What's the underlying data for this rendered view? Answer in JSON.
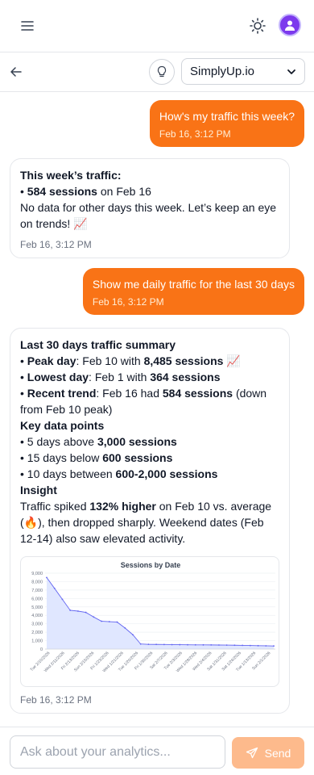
{
  "header": {
    "menu_icon": "hamburger-icon",
    "theme_icon": "sun-icon",
    "avatar_icon": "user-icon"
  },
  "subheader": {
    "back_icon": "arrow-left-icon",
    "bulb_icon": "lightbulb-icon",
    "site_select": {
      "selected": "SimplyUp.io"
    }
  },
  "messages": [
    {
      "role": "user",
      "text": "How's my traffic this week?",
      "time": "Feb 16, 3:12 PM"
    },
    {
      "role": "assistant",
      "heading": "This week’s traffic:",
      "line1_bold": "584 sessions",
      "line1_rest": " on Feb 16",
      "line2": "No data for other days this week. Let’s keep an eye on trends! 📈",
      "time": "Feb 16, 3:12 PM"
    },
    {
      "role": "user",
      "text": "Show me daily traffic for the last 30 days",
      "time": "Feb 16, 3:12 PM"
    },
    {
      "role": "assistant",
      "title": "Last 30 days traffic summary",
      "peak_label": "Peak day",
      "peak_mid": ": Feb 10 with ",
      "peak_value": "8,485 sessions",
      "peak_emoji": " 📈",
      "lowest_label": "Lowest day",
      "lowest_mid": ": Feb 1 with ",
      "lowest_value": "364 sessions",
      "recent_label": "Recent trend",
      "recent_mid": ": Feb 16 had ",
      "recent_value": "584 sessions",
      "recent_rest": " (down from Feb 10 peak)",
      "key_heading": "Key data points",
      "kp1_pre": "5 days above ",
      "kp1_bold": "3,000 sessions",
      "kp2_pre": "15 days below ",
      "kp2_bold": "600 sessions",
      "kp3_pre": "10 days between ",
      "kp3_bold": "600-2,000 sessions",
      "insight_heading": "Insight",
      "insight_pre": "Traffic spiked ",
      "insight_bold": "132% higher",
      "insight_rest": " on Feb 10 vs. average (🔥), then dropped sharply. Weekend dates (Feb 12-14) also saw elevated activity.",
      "time": "Feb 16, 3:12 PM"
    }
  ],
  "chart_data": {
    "type": "area",
    "title": "Sessions by Date",
    "ylim": [
      0,
      9000
    ],
    "yticks": [
      "0",
      "1,000",
      "2,000",
      "3,000",
      "4,000",
      "5,000",
      "6,000",
      "7,000",
      "8,000",
      "9,000"
    ],
    "xticks": [
      "Tue 2/10/2026",
      "Wed 2/11/2026",
      "Fri 2/13/2026",
      "Sun 2/15/2026",
      "Fri 1/23/2026",
      "Wed 1/21/2026",
      "Tue 1/20/2026",
      "Fri 1/30/2026",
      "Sat 2/7/2026",
      "Tue 2/3/2026",
      "Wed 1/28/2026",
      "Wed 2/4/2026",
      "Sat 1/31/2026",
      "Sat 1/24/2026",
      "Tue 1/13/2026",
      "Sun 2/1/2026"
    ],
    "values": [
      8485,
      7200,
      5900,
      4600,
      4500,
      4350,
      3800,
      3300,
      3250,
      3200,
      2500,
      1700,
      600,
      560,
      550,
      540,
      530,
      520,
      510,
      500,
      495,
      490,
      480,
      470,
      455,
      440,
      420,
      400,
      385,
      364
    ],
    "grid": true,
    "legend": "none",
    "line_color": "#6366f1",
    "fill_color": "#e0e7ff"
  },
  "composer": {
    "placeholder": "Ask about your analytics...",
    "send_label": "Send",
    "send_icon": "paper-plane-icon"
  },
  "colors": {
    "accent": "#f97316",
    "accent_disabled": "#fdba8c",
    "avatar": "#7c3aed"
  }
}
